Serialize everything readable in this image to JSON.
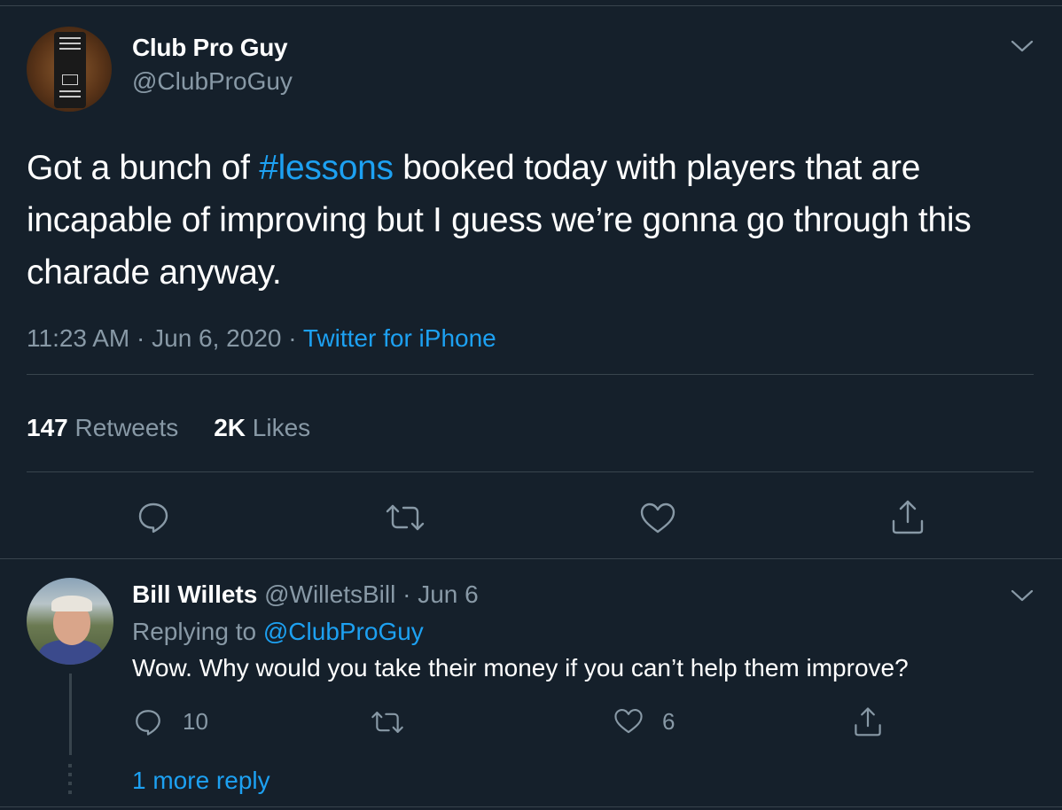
{
  "tweet": {
    "author_name": "Club Pro Guy",
    "author_handle": "@ClubProGuy",
    "text_before": "Got a bunch of ",
    "hashtag": "#lessons",
    "text_after": " booked today with players that are incapable of improving but I guess we’re gonna go through this charade anyway.",
    "time": "11:23 AM",
    "date": "Jun 6, 2020",
    "dot": "·",
    "source": "Twitter for iPhone",
    "retweets_count": "147",
    "retweets_label": "Retweets",
    "likes_count": "2K",
    "likes_label": "Likes"
  },
  "reply": {
    "author_name": "Bill Willets",
    "author_handle": "@WilletsBill",
    "dot": "·",
    "date": "Jun 6",
    "replying_label": "Replying to",
    "replying_to": "@ClubProGuy",
    "text": "Wow. Why would you take their money if you can’t help them improve?",
    "reply_count": "10",
    "like_count": "6"
  },
  "more_replies": "1 more reply",
  "icons": {
    "reply": "reply-icon",
    "retweet": "retweet-icon",
    "like": "heart-icon",
    "share": "share-icon",
    "menu": "chevron-down-icon"
  },
  "colors": {
    "background": "#15202b",
    "accent": "#1da1f2",
    "secondary_text": "#8899a6",
    "border": "#38444d"
  }
}
